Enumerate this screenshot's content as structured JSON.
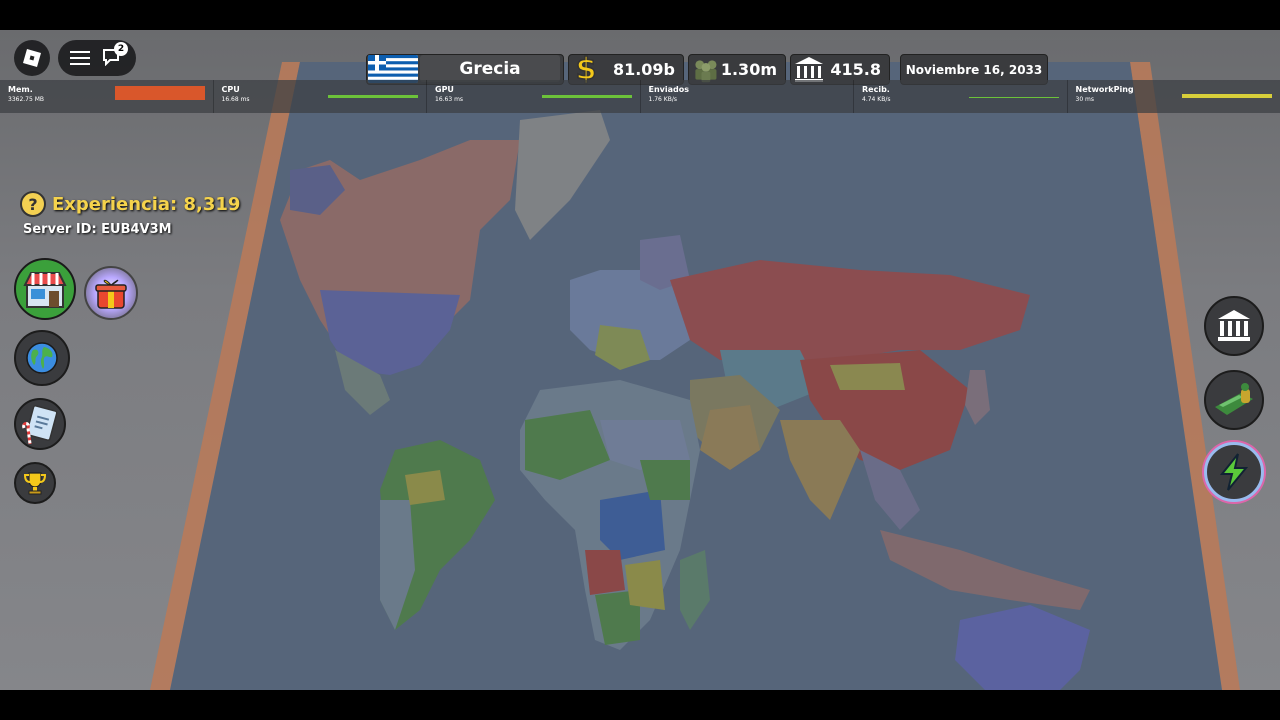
{
  "roblox": {
    "notification_count": "2"
  },
  "topbar": {
    "country": "Grecia",
    "money": "81.09b",
    "troops": "1.30m",
    "stability": "415.8",
    "date": "Noviembre 16, 2033"
  },
  "perf": [
    {
      "label": "Mem.",
      "sub": "3362.75 MB",
      "color": "#d9572b"
    },
    {
      "label": "CPU",
      "sub": "16.68 ms",
      "color": "#6cc23a"
    },
    {
      "label": "GPU",
      "sub": "16.63 ms",
      "color": "#6cc23a"
    },
    {
      "label": "Enviados",
      "sub": "1.76 KB/s",
      "color": ""
    },
    {
      "label": "Recib.",
      "sub": "4.74 KB/s",
      "color": "#6cc23a"
    },
    {
      "label": "NetworkPing",
      "sub": "30 ms",
      "color": "#d8cf3a"
    }
  ],
  "left": {
    "experience": "Experiencia: 8,319",
    "server_id": "Server ID: EUB4V3M"
  },
  "icons": {
    "roblox": "roblox-logo-icon",
    "menu": "hamburger-menu-icon",
    "chat": "chat-icon",
    "money": "dollar-icon",
    "troops": "soldiers-icon",
    "stability": "bank-icon",
    "help": "question-icon",
    "shop": "shop-icon",
    "gift": "gift-icon",
    "world": "globe-icon",
    "missions": "clipboard-icon",
    "trophy": "trophy-icon",
    "government": "bank-icon",
    "military": "tank-icon",
    "powers": "lightning-icon"
  },
  "colors": {
    "accent_yellow": "#f5d34c",
    "mem_bar": "#d9572b",
    "ok_bar": "#6cc23a",
    "ping_bar": "#d8cf3a",
    "greece_blue": "#0d5eaf"
  }
}
